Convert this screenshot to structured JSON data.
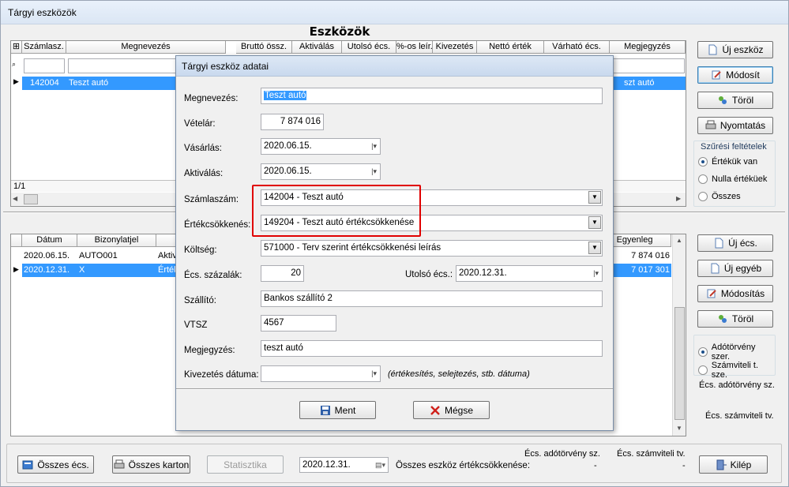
{
  "window": {
    "title": "Tárgyi eszközök"
  },
  "page_title": "Eszközök",
  "assets_grid": {
    "columns": [
      "Számlasz.",
      "Megnevezés",
      "Bruttó össz.",
      "Aktiválás",
      "Utolsó écs.",
      "%-os leír.",
      "Kivezetés",
      "Nettó érték",
      "Várható écs.",
      "Megjegyzés"
    ],
    "row": {
      "account": "142004",
      "name": "Teszt autó",
      "note_partial": "szt autó"
    },
    "status": "1/1"
  },
  "side_buttons": {
    "new_asset": "Új eszköz",
    "modify": "Módosít",
    "delete": "Töröl",
    "print": "Nyomtatás"
  },
  "filter": {
    "title": "Szűrési feltételek",
    "options": [
      "Értékük van",
      "Nulla értéküek",
      "Összes"
    ],
    "selected": 0
  },
  "depr_grid": {
    "columns": [
      "Dátum",
      "Bizonylatjel",
      "Egyenleg"
    ],
    "rows": [
      {
        "date": "2020.06.15.",
        "doc": "AUTO001",
        "mid": "Aktiv",
        "balance": "7 874 016"
      },
      {
        "date": "2020.12.31.",
        "doc": "X",
        "mid": "Érték",
        "balance": "7 017 301"
      }
    ]
  },
  "depr_buttons": {
    "new_depr": "Új écs.",
    "new_other": "Új egyéb",
    "modify": "Módosítás",
    "delete": "Töröl"
  },
  "mode": {
    "options": [
      "Adótörvény szer.",
      "Számviteli t. sze."
    ],
    "selected": 0,
    "tax_depr_label": "Écs. adótörvény sz.",
    "acc_depr_label": "Écs. számviteli tv."
  },
  "bottom": {
    "total_depr": "Összes écs.",
    "total_card": "Összes karton",
    "statistics": "Statisztika",
    "date": "2020.12.31.",
    "total_label": "Összes eszköz értékcsökkenése:",
    "col_tax": "Écs. adótörvény sz.",
    "col_acc": "Écs. számviteli tv.",
    "val_tax": "-",
    "val_acc": "-",
    "exit": "Kilép"
  },
  "dialog": {
    "title": "Tárgyi eszköz adatai",
    "labels": {
      "name": "Megnevezés:",
      "price": "Vételár:",
      "purchase": "Vásárlás:",
      "activation": "Aktiválás:",
      "account": "Számlaszám:",
      "depreciation": "Értékcsökkenés:",
      "cost": "Költség:",
      "rate": "Écs. százalák:",
      "last_depr": "Utolsó écs.:",
      "supplier": "Szállító:",
      "vtsz": "VTSZ",
      "note": "Megjegyzés:",
      "disposal_date": "Kivezetés dátuma:"
    },
    "values": {
      "name": "Teszt autó",
      "price": "7 874 016",
      "purchase": "2020.06.15.",
      "activation": "2020.06.15.",
      "account": "142004 - Teszt autó",
      "depreciation": "149204 - Teszt autó értékcsökkenése",
      "cost": "571000 - Terv szerint értékcsökkenési leírás",
      "rate": "20",
      "last_depr": "2020.12.31.",
      "supplier": "Bankos szállító 2",
      "vtsz": "4567",
      "note": "teszt autó",
      "disposal_date": ""
    },
    "disposal_hint": "(értékesítés, selejtezés, stb. dátuma)",
    "save": "Ment",
    "cancel": "Mégse"
  },
  "colors": {
    "selection": "#3399ff",
    "highlight_box": "#e00000"
  }
}
